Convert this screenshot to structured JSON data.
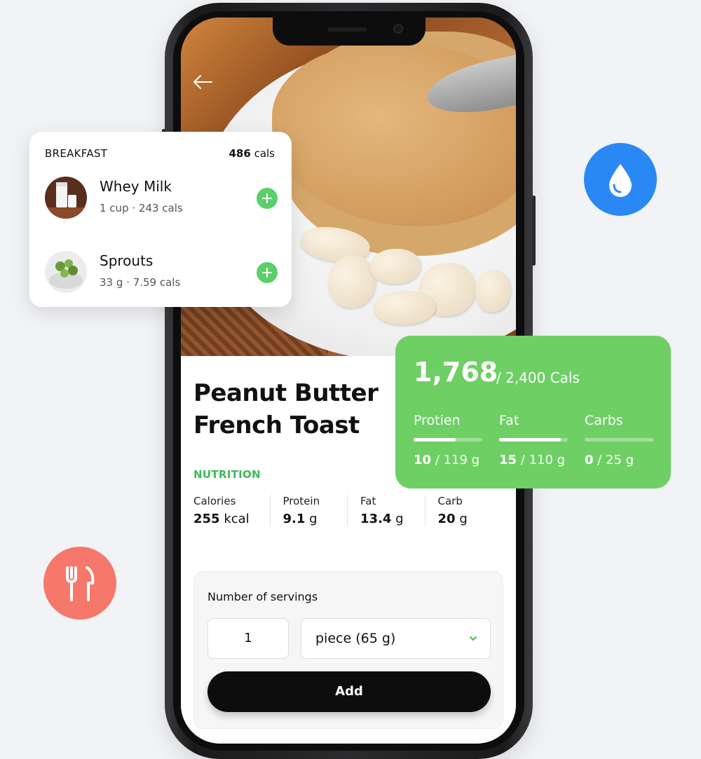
{
  "breakfast": {
    "title": "BREAKFAST",
    "total_cals_value": "486",
    "total_cals_unit": "cals",
    "items": [
      {
        "name": "Whey Milk",
        "amount": "1 cup",
        "cals": "243 cals"
      },
      {
        "name": "Sprouts",
        "amount": "33 g",
        "cals": "7.59 cals"
      }
    ]
  },
  "summary": {
    "consumed": "1,768",
    "goal": "/ 2,400 Cals",
    "macros": [
      {
        "name": "Protien",
        "value": "10",
        "target": "/ 119 g",
        "progress": 0.61
      },
      {
        "name": "Fat",
        "value": "15",
        "target": "/ 110 g",
        "progress": 0.9
      },
      {
        "name": "Carbs",
        "value": "0",
        "target": "/ 25 g",
        "progress": 0.0
      }
    ]
  },
  "food": {
    "title_line1": "Peanut Butter",
    "title_line2": "French Toast",
    "nutrition_label": "NUTRITION",
    "nutrition": [
      {
        "label": "Calories",
        "value": "255",
        "unit": "kcal"
      },
      {
        "label": "Protein",
        "value": "9.1",
        "unit": "g"
      },
      {
        "label": "Fat",
        "value": "13.4",
        "unit": "g"
      },
      {
        "label": "Carb",
        "value": "20",
        "unit": "g"
      }
    ]
  },
  "servings": {
    "label": "Number of servings",
    "quantity": "1",
    "unit": "piece (65 g)",
    "add_label": "Add"
  },
  "icons": {
    "back": "back-arrow-icon",
    "water": "water-drop-icon",
    "meal": "fork-knife-icon",
    "add": "plus-icon",
    "dropdown": "chevron-down-icon"
  },
  "colors": {
    "accent_green": "#6ecf65",
    "plus_green": "#5bcf6a",
    "nutrition_green": "#3dbb58",
    "water_blue": "#2a88f4",
    "meal_coral": "#f6786a",
    "button_black": "#0d0d0d"
  }
}
